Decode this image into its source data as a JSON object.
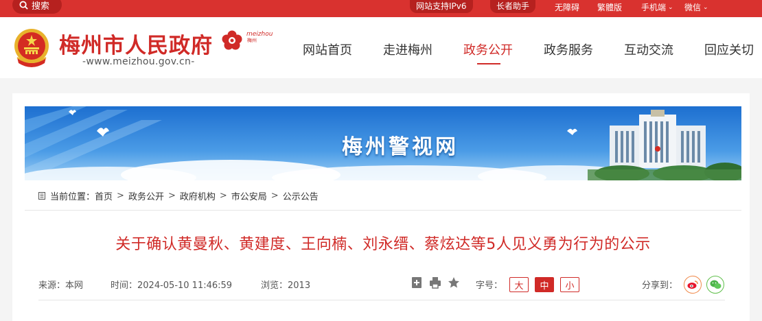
{
  "topbar": {
    "search_label": "搜索",
    "ipv6_label": "网站支持IPv6",
    "elder_label": "长者助手",
    "accessible_label": "无障碍",
    "traditional_label": "繁體版",
    "mobile_label": "手机端",
    "wechat_label": "微信"
  },
  "header": {
    "site_name": "梅州市人民政府",
    "site_url": "-www.meizhou.gov.cn-",
    "logo_en": "meizhou",
    "logo_cn": "梅州"
  },
  "nav": {
    "items": [
      {
        "label": "网站首页"
      },
      {
        "label": "走进梅州"
      },
      {
        "label": "政务公开"
      },
      {
        "label": "政务服务"
      },
      {
        "label": "互动交流"
      },
      {
        "label": "回应关切"
      }
    ],
    "active_index": 2
  },
  "banner": {
    "title": "梅州警视网"
  },
  "breadcrumb": {
    "prefix": "当前位置：",
    "items": [
      "首页",
      "政务公开",
      "政府机构",
      "市公安局",
      "公示公告"
    ],
    "separator": ">"
  },
  "article": {
    "title": "关于确认黄曼秋、黄建度、王向楠、刘永缙、蔡炫达等5人见义勇为行为的公示",
    "source_label": "来源：本网",
    "time_label": "时间：2024-05-10 11:46:59",
    "views_label": "浏览：2013",
    "font_size_label": "字号：",
    "font_sizes": [
      "大",
      "中",
      "小"
    ],
    "font_size_active": "中",
    "share_label": "分享到："
  },
  "colors": {
    "brand_red": "#d02a27",
    "topbar_red": "#d9322f",
    "dark_red_pill": "#b6211f"
  }
}
